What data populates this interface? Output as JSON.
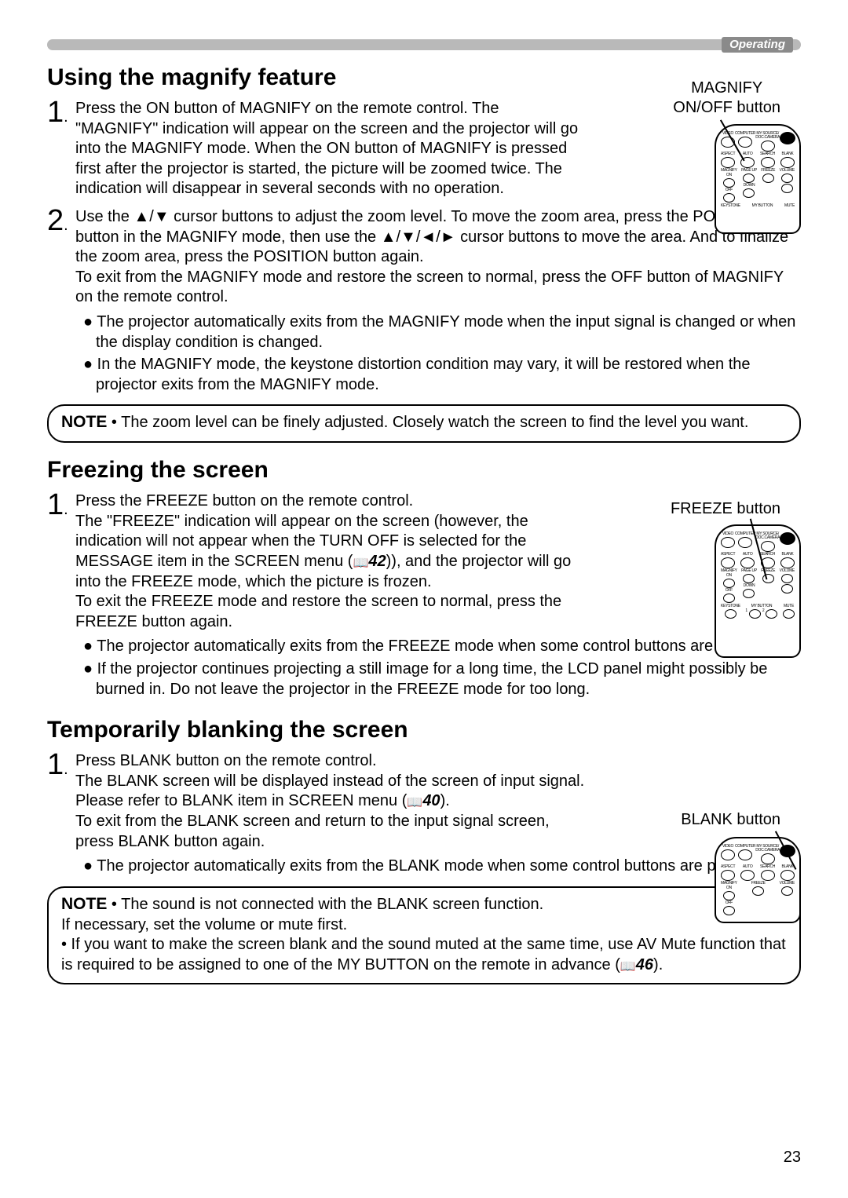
{
  "header": {
    "operating": "Operating"
  },
  "magnify": {
    "title": "Using the magnify feature",
    "button_label_l1": "MAGNIFY",
    "button_label_l2": "ON/OFF button",
    "step1": "Press the ON button of MAGNIFY on the remote control.\nThe \"MAGNIFY\" indication will appear on the screen and the projector will go into the MAGNIFY mode. When the ON button of MAGNIFY is pressed first after the projector is started, the picture will be zoomed twice. The indication will disappear in several seconds with no operation.",
    "step2": "Use the ▲/▼ cursor buttons to adjust the zoom level. To move the zoom area, press the POSITION button in the MAGNIFY mode, then use the ▲/▼/◄/► cursor buttons to move the area. And to finalize the zoom area, press the POSITION button again.\nTo exit from the MAGNIFY mode and restore the screen to normal, press the OFF button of MAGNIFY on the remote control.",
    "bullets": [
      "The projector automatically exits from the MAGNIFY mode when the input signal is changed or when the display condition is changed.",
      "In the MAGNIFY mode, the keystone distortion condition may vary, it will be restored when the projector exits from the MAGNIFY mode."
    ],
    "note_label": "NOTE",
    "note_text": " • The zoom level can be finely adjusted. Closely watch the screen to find the level you want."
  },
  "freeze": {
    "title": "Freezing the screen",
    "button_label": "FREEZE button",
    "step1_a": "Press the FREEZE button on the remote control.\nThe \"FREEZE\" indication will appear on the screen (however, the indication will not appear when the TURN OFF is selected for the MESSAGE item in the SCREEN menu (",
    "step1_ref": "42",
    "step1_b": ")), and the projector will go into the FREEZE mode, which the picture is frozen.\nTo exit the FREEZE mode and restore the screen to normal, press the FREEZE button again.",
    "bullets": [
      "The projector automatically exits from the FREEZE mode when some control buttons are pressed.",
      "If the projector continues projecting a still image for a long time, the LCD panel might possibly be burned in. Do not leave the projector in the FREEZE mode for too long."
    ]
  },
  "blank": {
    "title": "Temporarily blanking the screen",
    "button_label": "BLANK  button",
    "step1_a": "Press BLANK  button on the remote control.\nThe BLANK screen will be displayed instead of the screen of input signal. Please refer to BLANK item in SCREEN menu (",
    "step1_ref": "40",
    "step1_b": ").\nTo exit from the BLANK screen and return to the input signal screen, press BLANK  button again.",
    "bullets": [
      "The projector automatically exits from the BLANK mode when some control buttons are pressed."
    ],
    "note_label": "NOTE",
    "note_text_a": " • The sound is not connected with the BLANK screen function.\nIf necessary, set the volume or mute first.\n• If you want to make the screen blank and the sound muted at the same time, use AV Mute function that is required to be assigned to one of the MY BUTTON on the remote in advance (",
    "note_ref": "46",
    "note_text_b": ")."
  },
  "remote_labels": {
    "video": "VIDEO",
    "computer": "COMPUTER",
    "mysource": "MY SOURCE/\nDOC.CAMERA",
    "aspect": "ASPECT",
    "auto": "AUTO",
    "search": "SEARCH",
    "blank": "BLANK",
    "magnify": "MAGNIFY",
    "on": "ON",
    "off": "OFF",
    "freeze": "FREEZE",
    "pageup": "PAGE UP",
    "pagedown": "DOWN",
    "volume": "VOLUME",
    "keystone": "KEYSTONE",
    "mybutton": "MY BUTTON",
    "mute": "MUTE",
    "one": "1",
    "two": "2"
  },
  "page_number": "23"
}
